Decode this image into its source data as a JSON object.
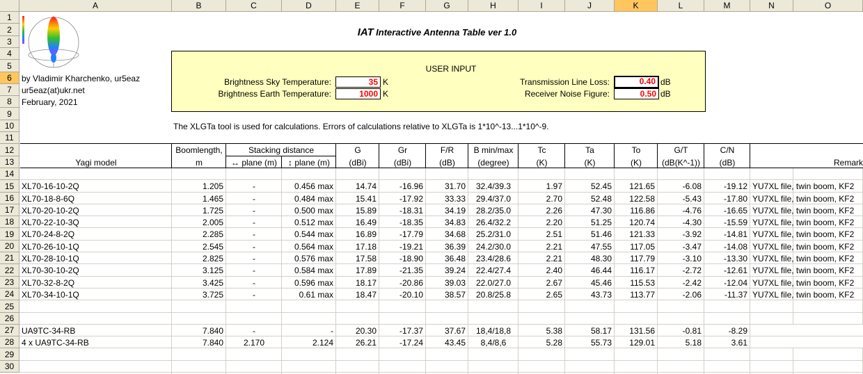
{
  "columns": [
    "A",
    "B",
    "C",
    "D",
    "E",
    "F",
    "G",
    "H",
    "I",
    "J",
    "K",
    "L",
    "M",
    "N",
    "O"
  ],
  "selected_column": "K",
  "rows": [
    "1",
    "2",
    "3",
    "4",
    "5",
    "6",
    "7",
    "8",
    "9",
    "10",
    "11",
    "12",
    "13",
    "14",
    "15",
    "16",
    "17",
    "18",
    "19",
    "20",
    "21",
    "22",
    "23",
    "24",
    "25",
    "26",
    "27",
    "28",
    "29",
    "30"
  ],
  "selected_row": "6",
  "title_big": "IAT",
  "title_small": "Interactive Antenna Table ver 1.0",
  "author": {
    "line1": "by Vladimir Kharchenko, ur5eaz",
    "line2": "ur5eaz(at)ukr.net",
    "line3": "February, 2021"
  },
  "user_input": {
    "heading": "USER INPUT",
    "sky_label": "Brightness Sky Temperature:",
    "sky_value": "35",
    "sky_unit": "K",
    "earth_label": "Brightness Earth Temperature:",
    "earth_value": "1000",
    "earth_unit": "K",
    "loss_label": "Transmission Line Loss:",
    "loss_value": "0.40",
    "loss_unit": "dB",
    "nf_label": "Receiver Noise Figure:",
    "nf_value": "0.50",
    "nf_unit": "dB"
  },
  "note": "The XLGTa tool is used for calculations. Errors of calculations relative to XLGTa is 1*10^-13...1*10^-9.",
  "headers": {
    "model": "Yagi model",
    "boom1": "Boomlength,",
    "boom2": "m",
    "stacking": "Stacking distance",
    "plane_h": "↔ plane (m)",
    "plane_v": "↕ plane (m)",
    "g1": "G",
    "g2": "(dBi)",
    "gr1": "Gr",
    "gr2": "(dBi)",
    "fr1": "F/R",
    "fr2": "(dB)",
    "b1": "B min/max",
    "b2": "(degree)",
    "tc1": "Tc",
    "tc2": "(K)",
    "ta1": "Ta",
    "ta2": "(K)",
    "to1": "To",
    "to2": "(K)",
    "gt1": "G/T",
    "gt2": "(dB(K^-1))",
    "cn1": "C/N",
    "cn2": "(dB)",
    "remark": "Remark"
  },
  "table": [
    {
      "row": 15,
      "model": "XL70-16-10-2Q",
      "boom": "1.205",
      "ph": "-",
      "pv": "0.456 max",
      "g": "14.74",
      "gr": "-16.96",
      "fr": "31.70",
      "b": "32.4/39.3",
      "tc": "1.97",
      "ta": "52.45",
      "to": "121.65",
      "gt": "-6.08",
      "cn": "-19.12",
      "remark": "YU7XL file, twin boom, KF2"
    },
    {
      "row": 16,
      "model": "XL70-18-8-6Q",
      "boom": "1.465",
      "ph": "-",
      "pv": "0.484 max",
      "g": "15.41",
      "gr": "-17.92",
      "fr": "33.33",
      "b": "29.4/37.0",
      "tc": "2.70",
      "ta": "52.48",
      "to": "122.58",
      "gt": "-5.43",
      "cn": "-17.80",
      "remark": "YU7XL file, twin boom, KF2"
    },
    {
      "row": 17,
      "model": "XL70-20-10-2Q",
      "boom": "1.725",
      "ph": "-",
      "pv": "0.500 max",
      "g": "15.89",
      "gr": "-18.31",
      "fr": "34.19",
      "b": "28.2/35.0",
      "tc": "2.26",
      "ta": "47.30",
      "to": "116.86",
      "gt": "-4.76",
      "cn": "-16.65",
      "remark": "YU7XL file, twin boom, KF2"
    },
    {
      "row": 18,
      "model": "XL70-22-10-3Q",
      "boom": "2.005",
      "ph": "-",
      "pv": "0.512 max",
      "g": "16.49",
      "gr": "-18.35",
      "fr": "34.83",
      "b": "26.4/32.2",
      "tc": "2.20",
      "ta": "51.25",
      "to": "120.74",
      "gt": "-4.30",
      "cn": "-15.59",
      "remark": "YU7XL file, twin boom, KF2"
    },
    {
      "row": 19,
      "model": "XL70-24-8-2Q",
      "boom": "2.285",
      "ph": "-",
      "pv": "0.544 max",
      "g": "16.89",
      "gr": "-17.79",
      "fr": "34.68",
      "b": "25.2/31.0",
      "tc": "2.51",
      "ta": "51.46",
      "to": "121.33",
      "gt": "-3.92",
      "cn": "-14.81",
      "remark": "YU7XL file, twin boom, KF2"
    },
    {
      "row": 20,
      "model": "XL70-26-10-1Q",
      "boom": "2.545",
      "ph": "-",
      "pv": "0.564 max",
      "g": "17.18",
      "gr": "-19.21",
      "fr": "36.39",
      "b": "24.2/30.0",
      "tc": "2.21",
      "ta": "47.55",
      "to": "117.05",
      "gt": "-3.47",
      "cn": "-14.08",
      "remark": "YU7XL file, twin boom, KF2"
    },
    {
      "row": 21,
      "model": "XL70-28-10-1Q",
      "boom": "2.825",
      "ph": "-",
      "pv": "0.576 max",
      "g": "17.58",
      "gr": "-18.90",
      "fr": "36.48",
      "b": "23.4/28.6",
      "tc": "2.21",
      "ta": "48.30",
      "to": "117.79",
      "gt": "-3.10",
      "cn": "-13.30",
      "remark": "YU7XL file, twin boom, KF2"
    },
    {
      "row": 22,
      "model": "XL70-30-10-2Q",
      "boom": "3.125",
      "ph": "-",
      "pv": "0.584 max",
      "g": "17.89",
      "gr": "-21.35",
      "fr": "39.24",
      "b": "22.4/27.4",
      "tc": "2.40",
      "ta": "46.44",
      "to": "116.17",
      "gt": "-2.72",
      "cn": "-12.61",
      "remark": "YU7XL file, twin boom, KF2"
    },
    {
      "row": 23,
      "model": "XL70-32-8-2Q",
      "boom": "3.425",
      "ph": "-",
      "pv": "0.596 max",
      "g": "18.17",
      "gr": "-20.86",
      "fr": "39.03",
      "b": "22.0/27.0",
      "tc": "2.67",
      "ta": "45.46",
      "to": "115.53",
      "gt": "-2.42",
      "cn": "-12.04",
      "remark": "YU7XL file, twin boom, KF2"
    },
    {
      "row": 24,
      "model": "XL70-34-10-1Q",
      "boom": "3.725",
      "ph": "-",
      "pv": "0.61 max",
      "g": "18.47",
      "gr": "-20.10",
      "fr": "38.57",
      "b": "20.8/25.8",
      "tc": "2.65",
      "ta": "43.73",
      "to": "113.77",
      "gt": "-2.06",
      "cn": "-11.37",
      "remark": "YU7XL file, twin boom, KF2"
    },
    {
      "row": 27,
      "model": "UA9TC-34-RB",
      "boom": "7.840",
      "ph": "-",
      "pv": "-",
      "g": "20.30",
      "gr": "-17.37",
      "fr": "37.67",
      "b": "18,4/18,8",
      "tc": "5.38",
      "ta": "58.17",
      "to": "131.56",
      "gt": "-0.81",
      "cn": "-8.29",
      "remark": ""
    },
    {
      "row": 28,
      "model": "4 x UA9TC-34-RB",
      "boom": "7.840",
      "ph": "2.170",
      "pv": "2.124",
      "g": "26.21",
      "gr": "-17.24",
      "fr": "43.45",
      "b": "8,4/8,6",
      "tc": "5.28",
      "ta": "55.73",
      "to": "129.01",
      "gt": "5.18",
      "cn": "3.61",
      "remark": ""
    }
  ]
}
